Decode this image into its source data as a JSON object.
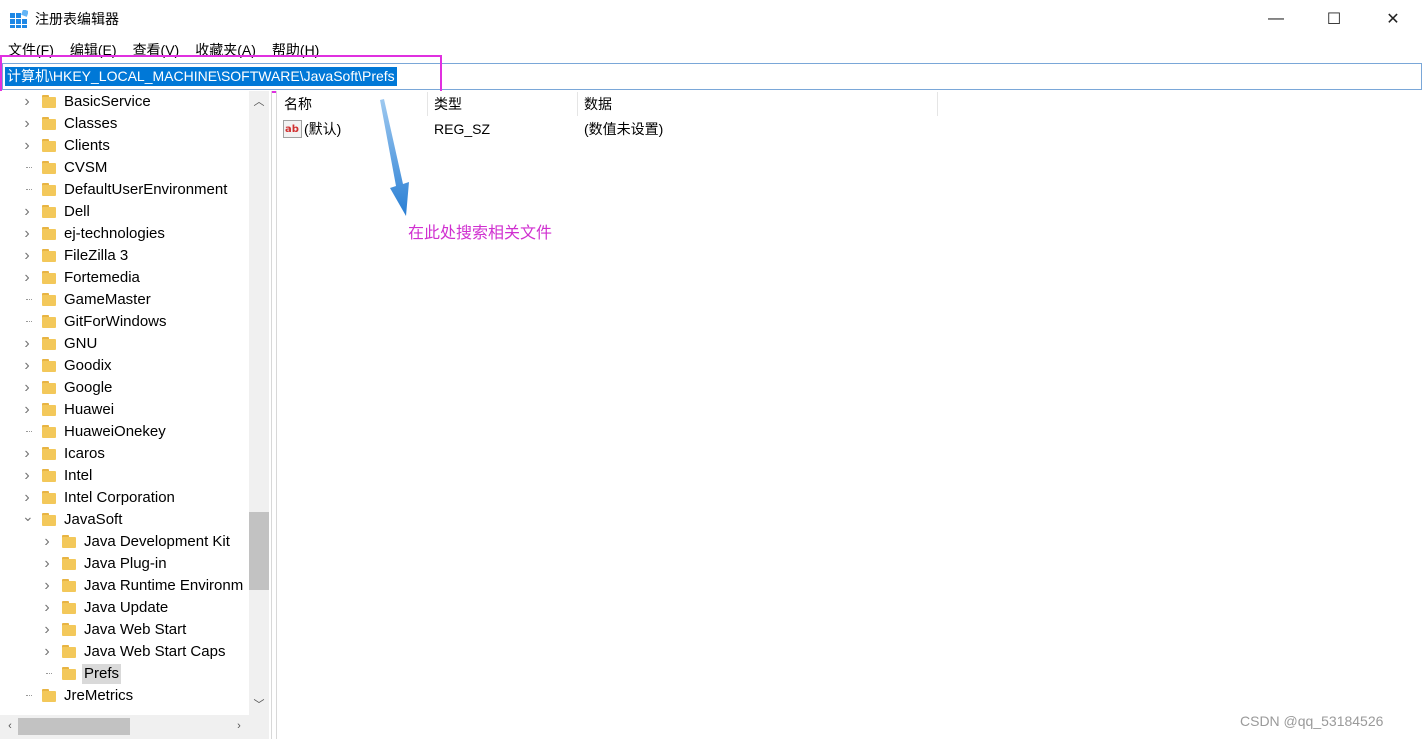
{
  "window": {
    "title": "注册表编辑器",
    "minimize_glyph": "—",
    "maximize_glyph": "☐",
    "close_glyph": "✕"
  },
  "menu": [
    "文件(F)",
    "编辑(E)",
    "查看(V)",
    "收藏夹(A)",
    "帮助(H)"
  ],
  "address": "计算机\\HKEY_LOCAL_MACHINE\\SOFTWARE\\JavaSoft\\Prefs",
  "tree": [
    {
      "label": "BasicService",
      "level": 0,
      "chevron": ">"
    },
    {
      "label": "Classes",
      "level": 0,
      "chevron": ">"
    },
    {
      "label": "Clients",
      "level": 0,
      "chevron": ">"
    },
    {
      "label": "CVSM",
      "level": 0,
      "chevron": ""
    },
    {
      "label": "DefaultUserEnvironment",
      "level": 0,
      "chevron": ""
    },
    {
      "label": "Dell",
      "level": 0,
      "chevron": ">"
    },
    {
      "label": "ej-technologies",
      "level": 0,
      "chevron": ">"
    },
    {
      "label": "FileZilla 3",
      "level": 0,
      "chevron": ">"
    },
    {
      "label": "Fortemedia",
      "level": 0,
      "chevron": ">"
    },
    {
      "label": "GameMaster",
      "level": 0,
      "chevron": ""
    },
    {
      "label": "GitForWindows",
      "level": 0,
      "chevron": ""
    },
    {
      "label": "GNU",
      "level": 0,
      "chevron": ">"
    },
    {
      "label": "Goodix",
      "level": 0,
      "chevron": ">"
    },
    {
      "label": "Google",
      "level": 0,
      "chevron": ">"
    },
    {
      "label": "Huawei",
      "level": 0,
      "chevron": ">"
    },
    {
      "label": "HuaweiOnekey",
      "level": 0,
      "chevron": ""
    },
    {
      "label": "Icaros",
      "level": 0,
      "chevron": ">"
    },
    {
      "label": "Intel",
      "level": 0,
      "chevron": ">"
    },
    {
      "label": "Intel Corporation",
      "level": 0,
      "chevron": ">"
    },
    {
      "label": "JavaSoft",
      "level": 0,
      "chevron": "v"
    },
    {
      "label": "Java Development Kit",
      "level": 1,
      "chevron": ">"
    },
    {
      "label": "Java Plug-in",
      "level": 1,
      "chevron": ">"
    },
    {
      "label": "Java Runtime Environm",
      "level": 1,
      "chevron": ">"
    },
    {
      "label": "Java Update",
      "level": 1,
      "chevron": ">"
    },
    {
      "label": "Java Web Start",
      "level": 1,
      "chevron": ">"
    },
    {
      "label": "Java Web Start Caps",
      "level": 1,
      "chevron": ">"
    },
    {
      "label": "Prefs",
      "level": 1,
      "chevron": "",
      "selected": true
    },
    {
      "label": "JreMetrics",
      "level": 0,
      "chevron": ""
    }
  ],
  "columns": [
    "名称",
    "类型",
    "数据"
  ],
  "rows": [
    {
      "name": "(默认)",
      "type": "REG_SZ",
      "data": "(数值未设置)"
    }
  ],
  "annotation": "在此处搜索相关文件",
  "watermark": "CSDN @qq_53184526",
  "colors": {
    "address_highlight": "#0078d7",
    "annotation": "#d030d0",
    "annotation_box": "#e030e0"
  }
}
